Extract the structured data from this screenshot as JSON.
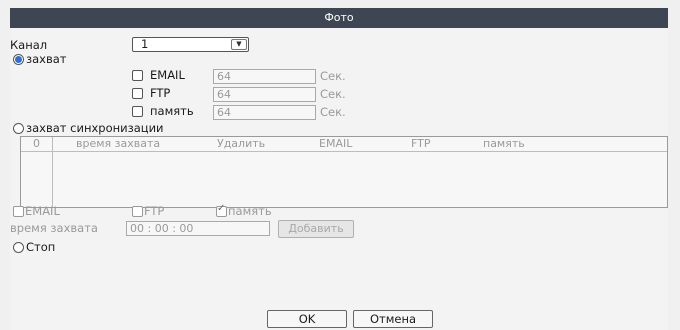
{
  "title": "Фото",
  "channel": {
    "label": "Канал",
    "value": "1"
  },
  "capture": {
    "label": "захват",
    "rows": [
      {
        "label": "EMAIL",
        "value": "64",
        "unit": "Сек."
      },
      {
        "label": "FTP",
        "value": "64",
        "unit": "Сек."
      },
      {
        "label": "память",
        "value": "64",
        "unit": "Сек."
      }
    ]
  },
  "sync": {
    "label": "захват синхронизации",
    "table_headers": [
      "0",
      "время захвата",
      "Удалить",
      "EMAIL",
      "FTP",
      "память"
    ],
    "email_label": "EMAIL",
    "ftp_label": "FTP",
    "memory_label": "память",
    "time_label": "время захвата",
    "time_value": "00 : 00 : 00",
    "add_label": "Добавить"
  },
  "stop": {
    "label": "Стоп"
  },
  "buttons": {
    "ok": "OK",
    "cancel": "Отмена"
  }
}
